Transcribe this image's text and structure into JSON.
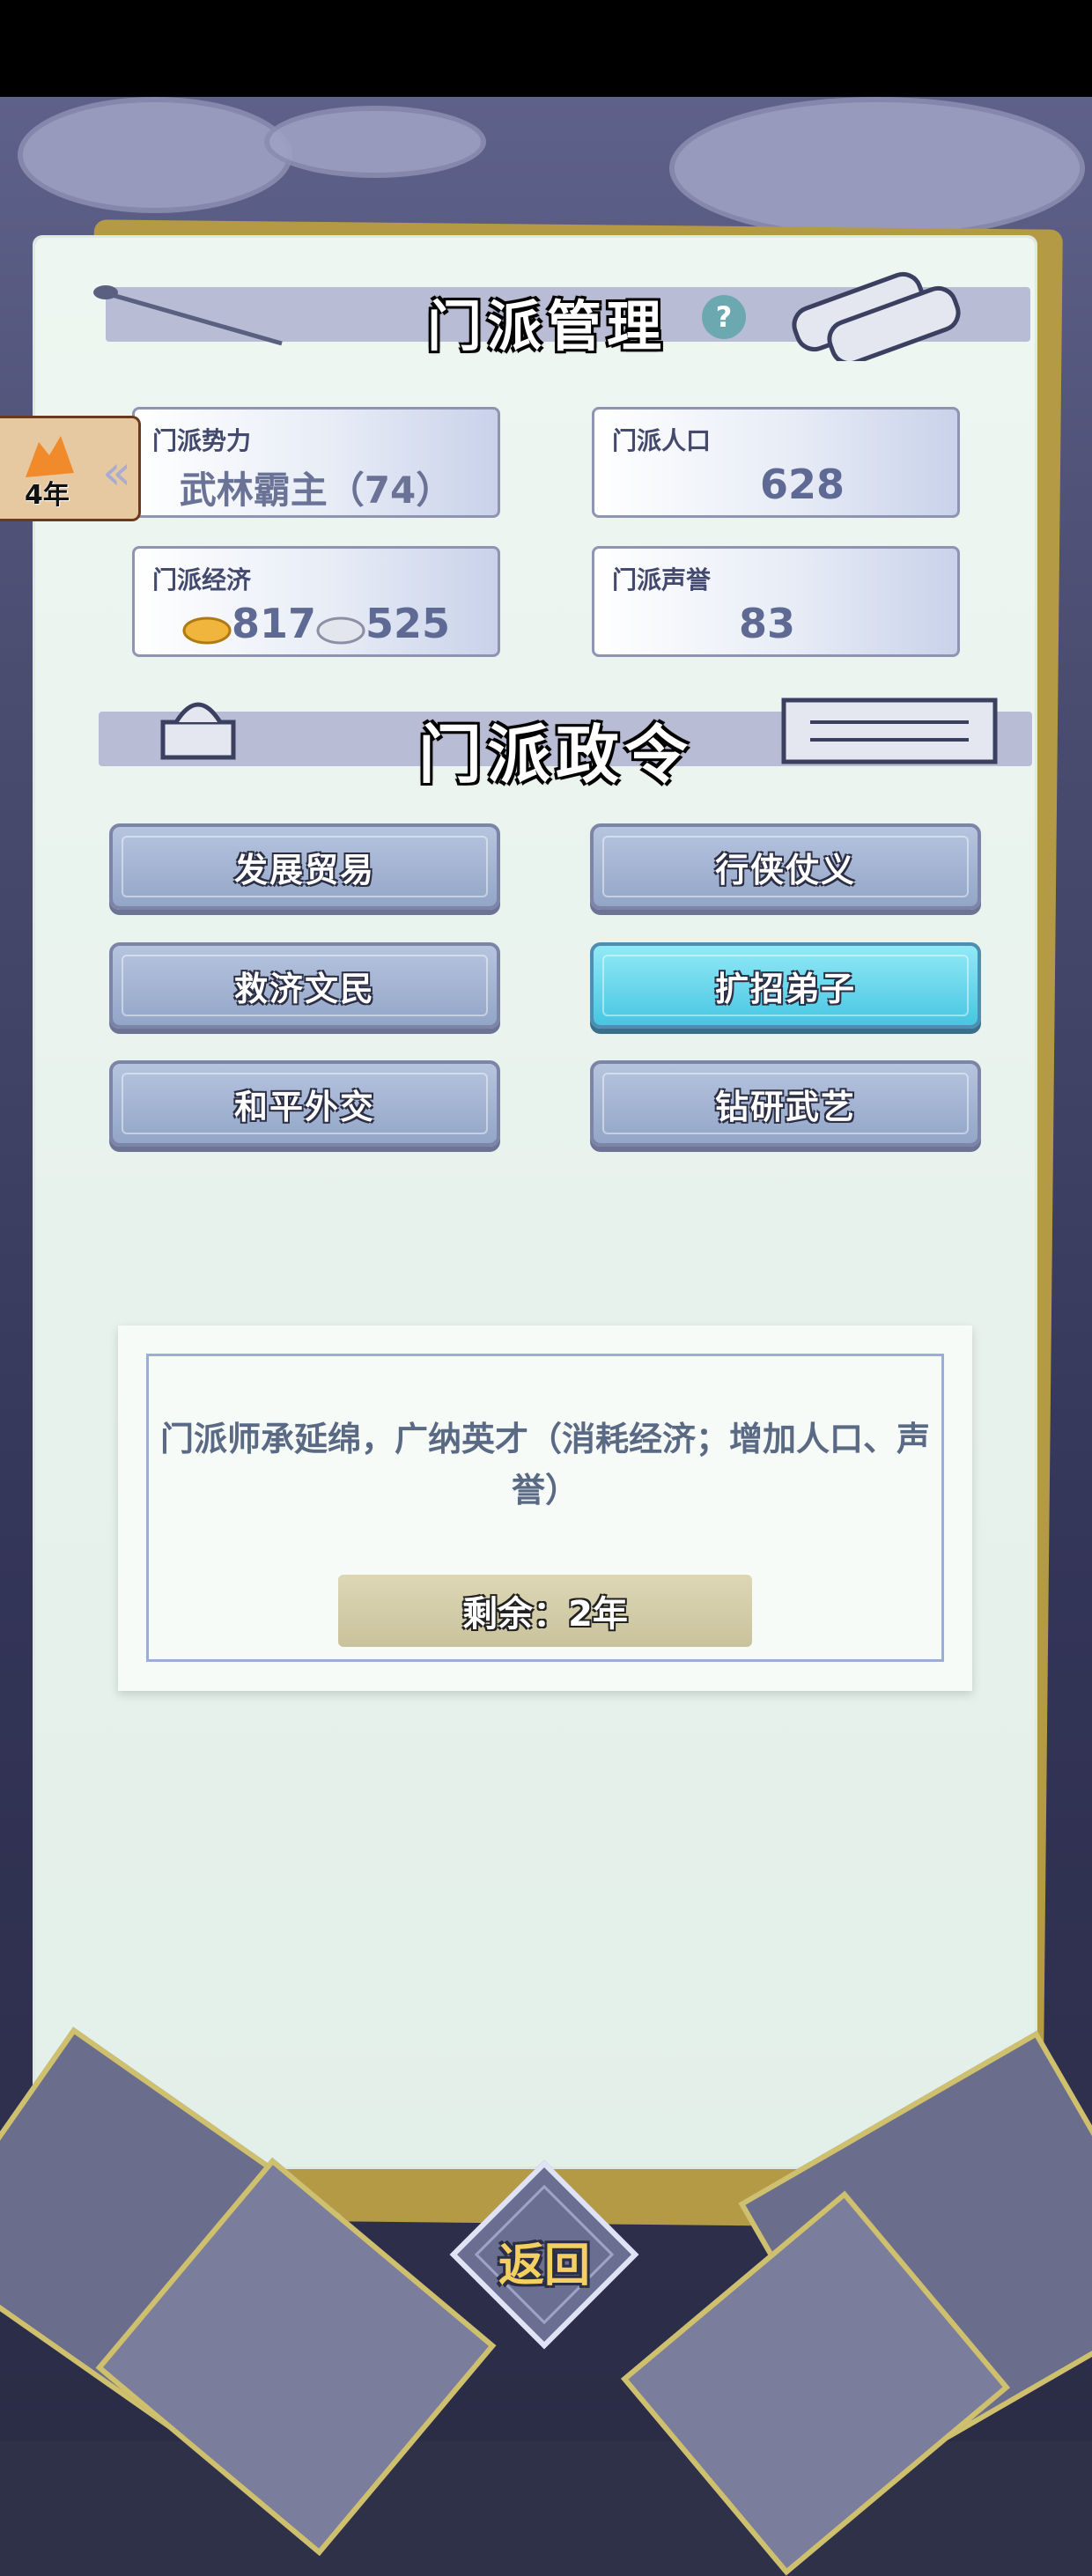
{
  "sect": {
    "title": "门派管理",
    "help_label": "?",
    "stats": {
      "power": {
        "label": "门派势力",
        "value": "武林霸主（74）"
      },
      "population": {
        "label": "门派人口",
        "value": "628"
      },
      "economy": {
        "label": "门派经济",
        "gold": "817",
        "silver": "525"
      },
      "reputation": {
        "label": "门派声誉",
        "value": "83"
      }
    }
  },
  "year_tab": {
    "label": "4年",
    "expand_icon": "double-chevron-left-icon"
  },
  "edicts": {
    "title": "门派政令",
    "items": [
      {
        "label": "发展贸易",
        "active": false
      },
      {
        "label": "行侠仗义",
        "active": false
      },
      {
        "label": "救济文民",
        "active": false
      },
      {
        "label": "扩招弟子",
        "active": true
      },
      {
        "label": "和平外交",
        "active": false
      },
      {
        "label": "钻研武艺",
        "active": false
      }
    ]
  },
  "description": {
    "text": "门派师承延绵，广纳英才（消耗经济；增加人口、声誉）",
    "remaining": "剩余：2年"
  },
  "back_button": {
    "label": "返回"
  },
  "colors": {
    "accent_active": "#47c6e2",
    "button_default": "#93a6c8",
    "back_text": "#f3d060",
    "paper": "#e9f3ee"
  }
}
